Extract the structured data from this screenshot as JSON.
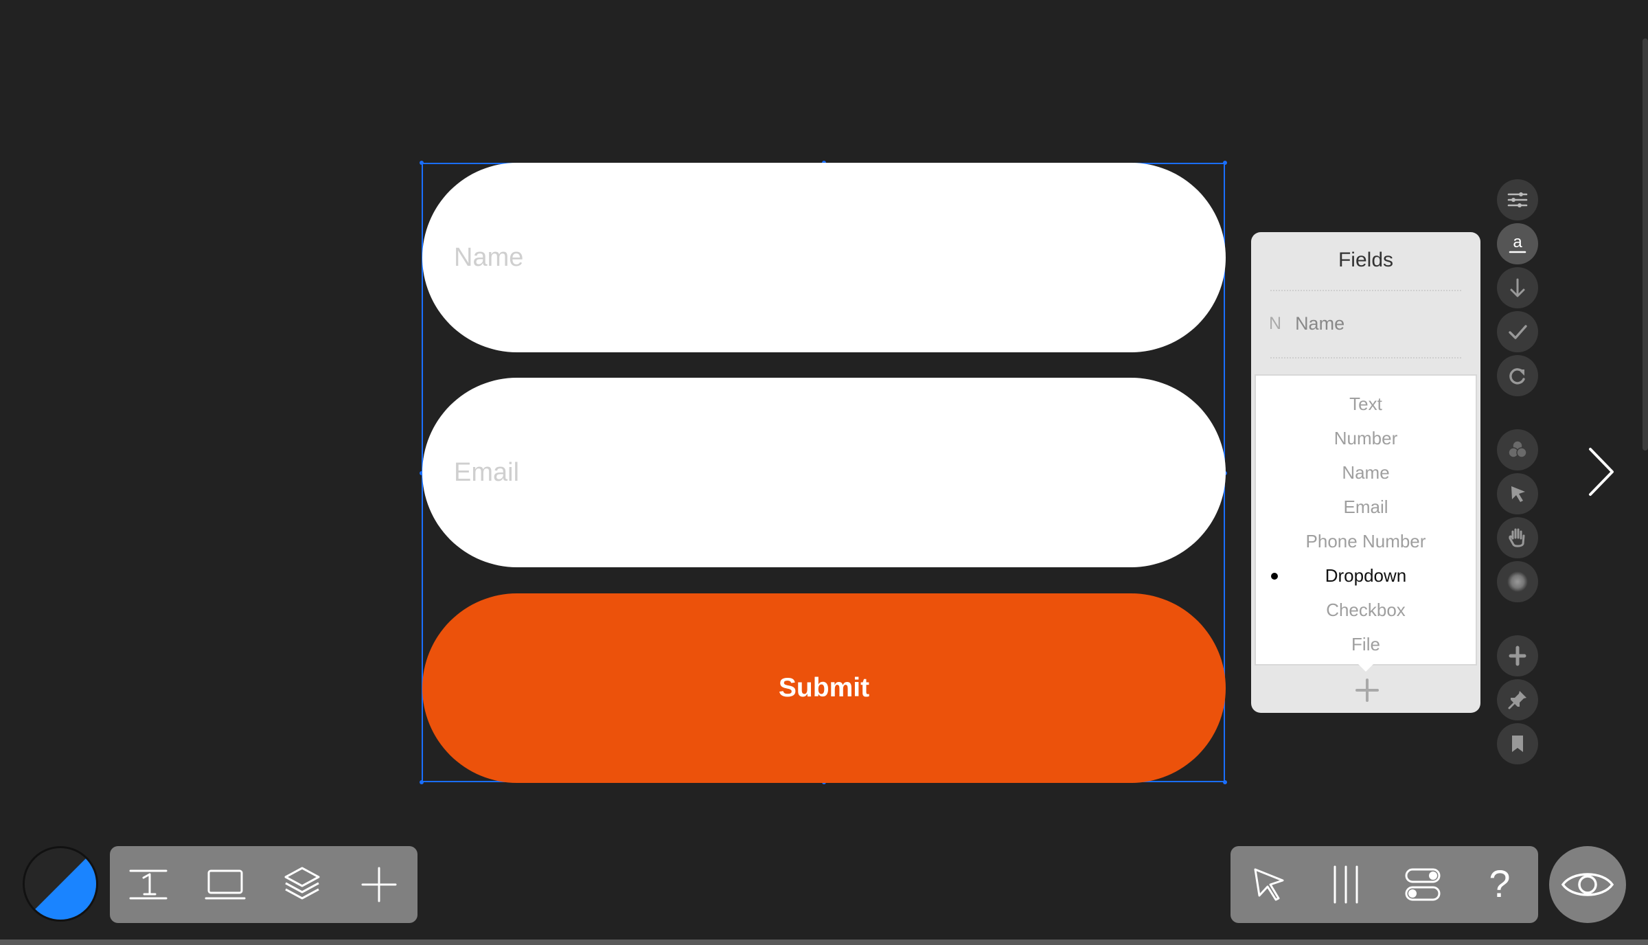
{
  "form": {
    "name_placeholder": "Name",
    "email_placeholder": "Email",
    "submit_label": "Submit",
    "submit_color": "#ec520b"
  },
  "fields_panel": {
    "title": "Fields",
    "field": {
      "initial": "N",
      "label": "Name"
    },
    "types": [
      "Text",
      "Number",
      "Name",
      "Email",
      "Phone Number",
      "Dropdown",
      "Checkbox",
      "File"
    ],
    "selected_type": "Dropdown",
    "add_icon": "plus-icon"
  },
  "right_tools": [
    "sliders-icon",
    "text-a-icon",
    "arrow-down-icon",
    "checkmark-icon",
    "redo-icon",
    "color-blend-icon",
    "pointer-icon",
    "hand-icon",
    "blur-icon",
    "plus-cross-icon",
    "pin-icon",
    "bookmark-icon"
  ],
  "bottom_left_tools": [
    "text-tool-icon",
    "device-icon",
    "layers-icon",
    "add-icon"
  ],
  "bottom_right_tools": [
    "select-icon",
    "columns-icon",
    "toggle-icon",
    "help-icon"
  ],
  "help_glyph": "?",
  "colors": {
    "background": "#222222",
    "accent": "#1a6fff",
    "toolbar": "#808080"
  }
}
